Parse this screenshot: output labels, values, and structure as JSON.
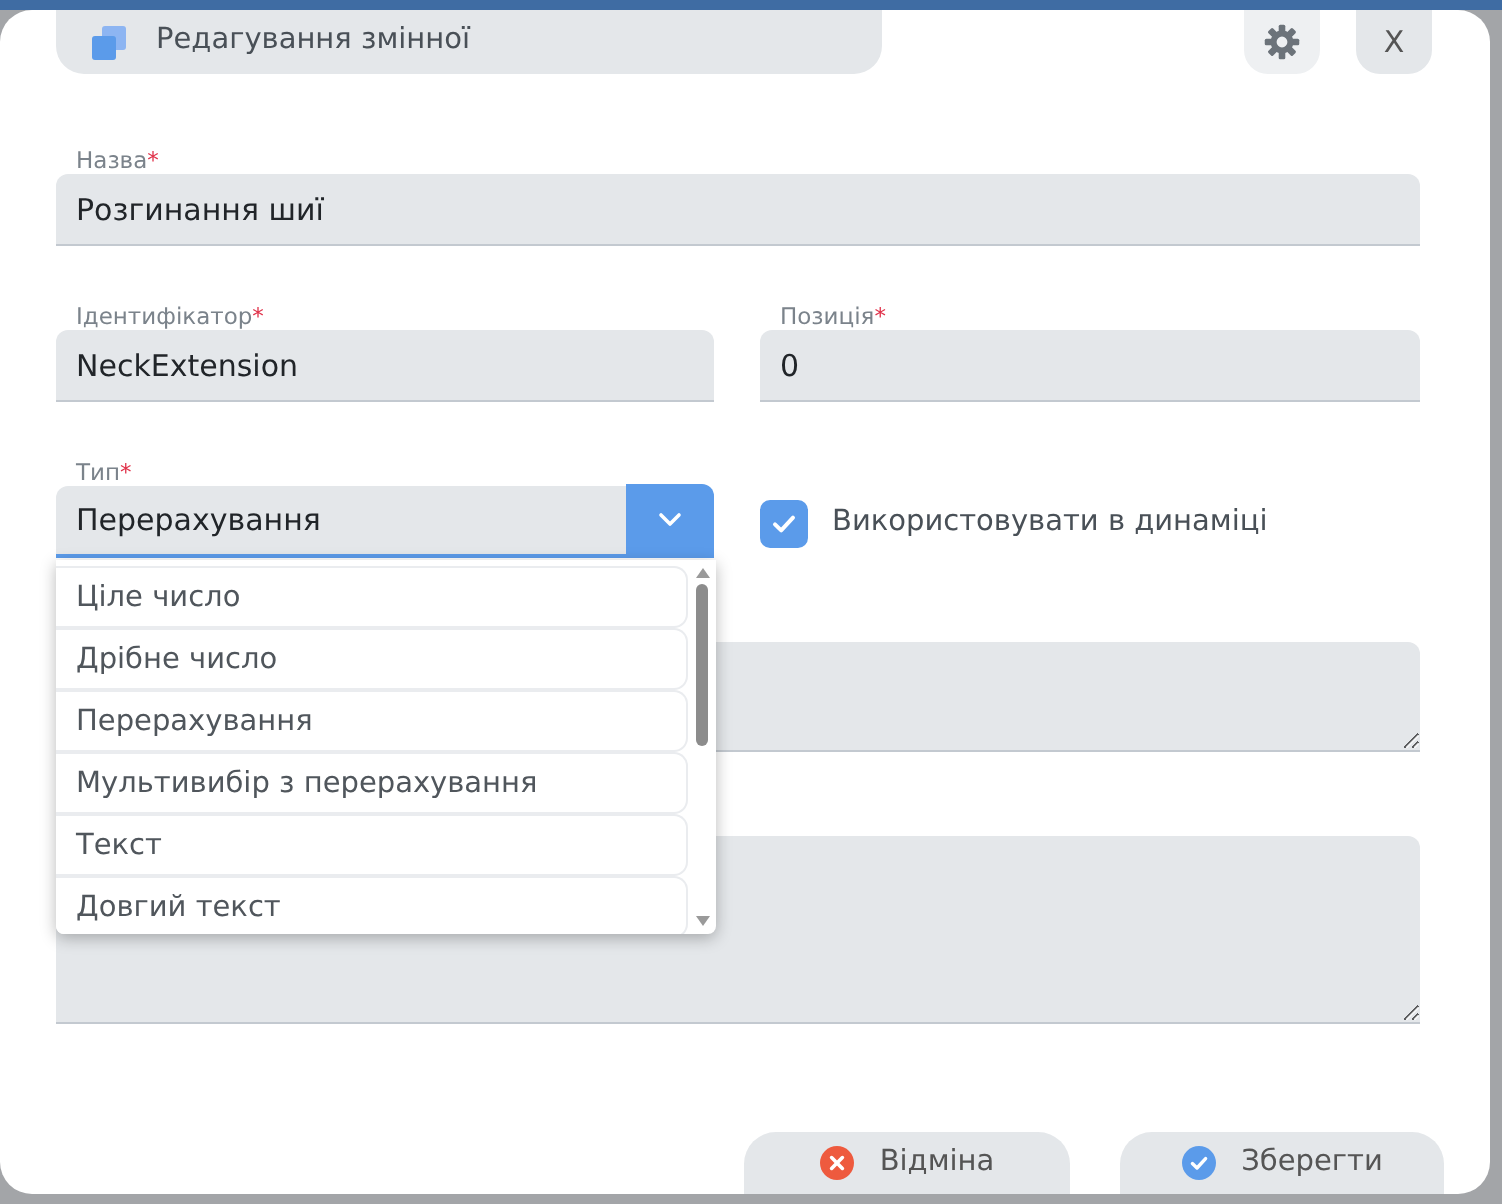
{
  "header": {
    "title": "Редагування змінної",
    "close_label": "X"
  },
  "name_field": {
    "label": "Назва",
    "required_mark": "*",
    "value": "Розгинання шиї"
  },
  "identifier_field": {
    "label": "Ідентифікатор",
    "required_mark": "*",
    "value": "NeckExtension"
  },
  "position_field": {
    "label": "Позиція",
    "required_mark": "*",
    "value": "0"
  },
  "type_select": {
    "label": "Тип",
    "required_mark": "*",
    "value": "Перерахування",
    "expanded": true,
    "options": [
      "Ціле число",
      "Дрібне число",
      "Перерахування",
      "Мультивибір з перерахування",
      "Текст",
      "Довгий текст"
    ]
  },
  "dynamics_checkbox": {
    "label": "Використовувати в динаміці",
    "checked": true
  },
  "text_areas": [
    {
      "kind": "short"
    },
    {
      "kind": "tall"
    }
  ],
  "buttons": [
    {
      "label": "Відміна",
      "kind": "cancel"
    },
    {
      "label": "Зберегти",
      "kind": "save"
    }
  ]
}
